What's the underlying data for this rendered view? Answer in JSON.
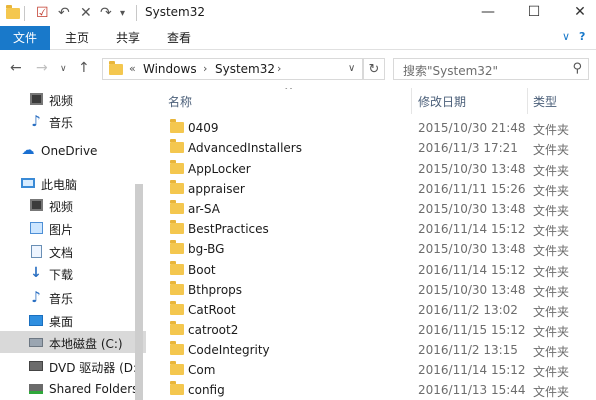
{
  "window": {
    "title": "System32",
    "minimize_glyph": "—",
    "maximize_glyph": "☐",
    "close_glyph": "✕"
  },
  "ribbon": {
    "tabs": [
      {
        "label": "文件",
        "active": true
      },
      {
        "label": "主页",
        "active": false
      },
      {
        "label": "共享",
        "active": false
      },
      {
        "label": "查看",
        "active": false
      }
    ],
    "collapse_glyph": "∨",
    "help_glyph": "?"
  },
  "address": {
    "overflow": "«",
    "segments": [
      "Windows",
      "System32"
    ],
    "separator": "›"
  },
  "search": {
    "placeholder": "搜索\"System32\""
  },
  "sidebar": {
    "items": [
      {
        "label": "视频",
        "icon": "video-icon"
      },
      {
        "label": "音乐",
        "icon": "music-icon"
      },
      {
        "label": "OneDrive",
        "icon": "onedrive-icon"
      },
      {
        "label": "此电脑",
        "icon": "this-pc-icon"
      },
      {
        "label": "视频",
        "icon": "video-icon"
      },
      {
        "label": "图片",
        "icon": "pictures-icon"
      },
      {
        "label": "文档",
        "icon": "documents-icon"
      },
      {
        "label": "下载",
        "icon": "downloads-icon"
      },
      {
        "label": "音乐",
        "icon": "music-icon"
      },
      {
        "label": "桌面",
        "icon": "desktop-icon"
      },
      {
        "label": "本地磁盘 (C:)",
        "icon": "local-disk-icon",
        "selected": true
      },
      {
        "label": "DVD 驱动器 (D:",
        "icon": "dvd-drive-icon"
      },
      {
        "label": "Shared Folders",
        "icon": "shared-folders-icon"
      }
    ]
  },
  "columns": {
    "name": "名称",
    "modified": "修改日期",
    "type": "类型",
    "sort_glyph": "^"
  },
  "files": [
    {
      "name": "0409",
      "modified": "2015/10/30 21:48",
      "type": "文件夹"
    },
    {
      "name": "AdvancedInstallers",
      "modified": "2016/11/3 17:21",
      "type": "文件夹"
    },
    {
      "name": "AppLocker",
      "modified": "2015/10/30 13:48",
      "type": "文件夹"
    },
    {
      "name": "appraiser",
      "modified": "2016/11/11 15:26",
      "type": "文件夹"
    },
    {
      "name": "ar-SA",
      "modified": "2015/10/30 13:48",
      "type": "文件夹"
    },
    {
      "name": "BestPractices",
      "modified": "2016/11/14 15:12",
      "type": "文件夹"
    },
    {
      "name": "bg-BG",
      "modified": "2015/10/30 13:48",
      "type": "文件夹"
    },
    {
      "name": "Boot",
      "modified": "2016/11/14 15:12",
      "type": "文件夹"
    },
    {
      "name": "Bthprops",
      "modified": "2015/10/30 13:48",
      "type": "文件夹"
    },
    {
      "name": "CatRoot",
      "modified": "2016/11/2 13:02",
      "type": "文件夹"
    },
    {
      "name": "catroot2",
      "modified": "2016/11/15 15:12",
      "type": "文件夹"
    },
    {
      "name": "CodeIntegrity",
      "modified": "2016/11/2 13:15",
      "type": "文件夹"
    },
    {
      "name": "Com",
      "modified": "2016/11/14 15:12",
      "type": "文件夹"
    },
    {
      "name": "config",
      "modified": "2016/11/13 15:44",
      "type": "文件夹"
    }
  ]
}
